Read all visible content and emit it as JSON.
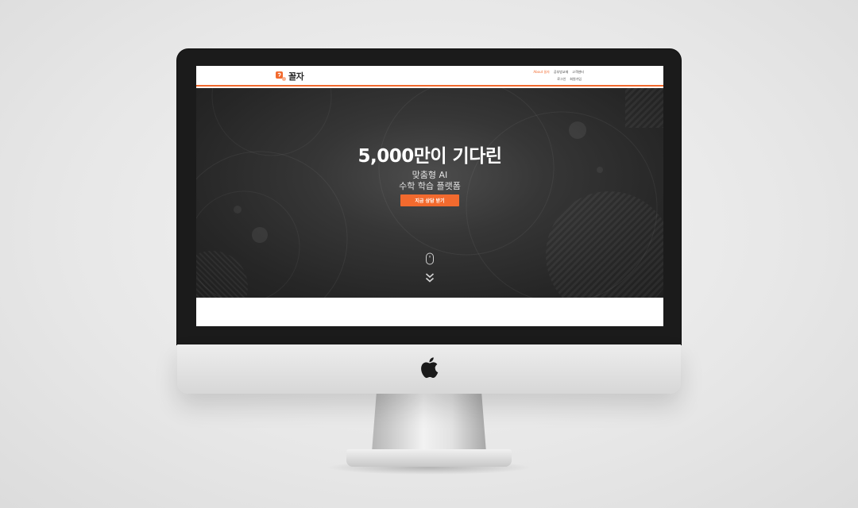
{
  "header": {
    "logo_text": "꼴자",
    "nav_top": [
      "About 꼴자",
      "공부방교재",
      "고객센터"
    ],
    "nav_bottom": [
      "로그인",
      "회원가입"
    ]
  },
  "hero": {
    "title": "5,000만이 기다린",
    "subtitle_line1": "맞춤형 AI",
    "subtitle_line2": "수학 학습 플랫폼",
    "cta_label": "지금 상담 받기"
  },
  "colors": {
    "accent": "#f26a2e",
    "hero_bg": "#2b2b2b",
    "bezel": "#1b1b1b"
  },
  "icons": [
    "apple-icon",
    "logo-mark-icon",
    "mouse-icon",
    "double-chevron-down-icon"
  ]
}
